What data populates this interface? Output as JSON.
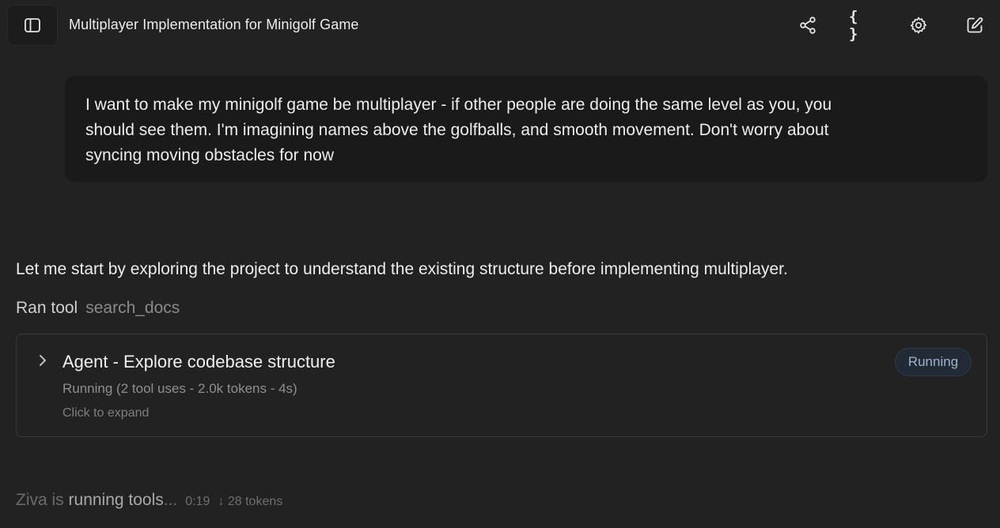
{
  "header": {
    "title": "Multiplayer Implementation for Minigolf Game",
    "braces_label": "{ }"
  },
  "user_message": {
    "text": "I want to make my minigolf game be multiplayer - if other people are doing the same level as you, you\nshould see them. I'm imagining names above the golfballs, and smooth movement. Don't worry about\nsyncing moving obstacles for now"
  },
  "assistant": {
    "text": "Let me start by exploring the project to understand the existing structure before implementing multiplayer.",
    "ran_tool_label": "Ran tool",
    "tool_name": "search_docs"
  },
  "agent_card": {
    "title": "Agent - Explore codebase structure",
    "status": "Running (2 tool uses - 2.0k tokens - 4s)",
    "hint": "Click to expand",
    "badge": "Running",
    "badge_color": "#9fb3cf"
  },
  "footer": {
    "prefix": "Ziva is ",
    "highlight": "running tools",
    "suffix": "...",
    "elapsed": "0:19",
    "tokens": "↓ 28 tokens"
  },
  "icons": {
    "sidebar": "sidebar-panel-icon",
    "share": "share-icon",
    "braces": "braces-icon",
    "settings": "gear-icon",
    "edit": "edit-icon",
    "chevron": "chevron-right-icon"
  }
}
